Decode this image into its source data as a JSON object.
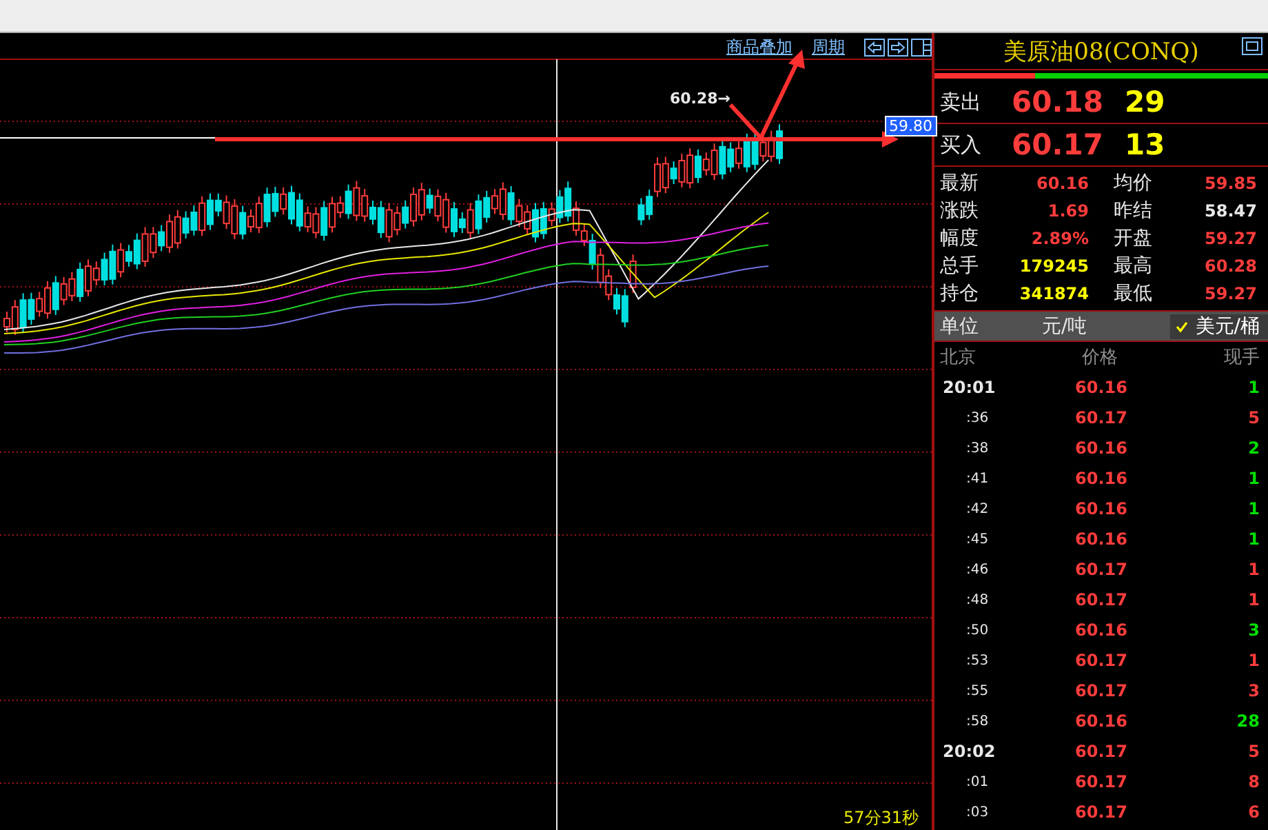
{
  "chart": {
    "links": [
      "商品叠加",
      "周期"
    ],
    "high_label": "60.28→",
    "price_tag": "59.80",
    "timer": "57分31秒"
  },
  "quote": {
    "title": "美原油08(CONQ)",
    "sell": {
      "label": "卖出",
      "price": "60.18",
      "volume": "29"
    },
    "buy": {
      "label": "买入",
      "price": "60.17",
      "volume": "13"
    },
    "stats": [
      {
        "label": "最新",
        "value": "60.16",
        "color": "#ff3c3c"
      },
      {
        "label": "均价",
        "value": "59.85",
        "color": "#ff3c3c"
      },
      {
        "label": "涨跌",
        "value": "1.69",
        "color": "#ff3c3c"
      },
      {
        "label": "昨结",
        "value": "58.47",
        "color": "#e8e8e8"
      },
      {
        "label": "幅度",
        "value": "2.89%",
        "color": "#ff3c3c"
      },
      {
        "label": "开盘",
        "value": "59.27",
        "color": "#ff3c3c"
      },
      {
        "label": "总手",
        "value": "179245",
        "color": "#ffff00"
      },
      {
        "label": "最高",
        "value": "60.28",
        "color": "#ff3c3c"
      },
      {
        "label": "持仓",
        "value": "341874",
        "color": "#ffff00"
      },
      {
        "label": "最低",
        "value": "59.27",
        "color": "#ff3c3c"
      }
    ],
    "units": {
      "label": "单位",
      "options": [
        {
          "label": "元/吨",
          "selected": false
        },
        {
          "label": "美元/桶",
          "selected": true
        }
      ]
    },
    "trades_header": [
      "北京",
      "价格",
      "现手"
    ],
    "trades": [
      {
        "time": "20:01",
        "major": true,
        "price": "60.16",
        "qty": "1",
        "color": "#00e000"
      },
      {
        "time": ":36",
        "major": false,
        "price": "60.17",
        "qty": "5",
        "color": "#ff3c3c"
      },
      {
        "time": ":38",
        "major": false,
        "price": "60.16",
        "qty": "2",
        "color": "#00e000"
      },
      {
        "time": ":41",
        "major": false,
        "price": "60.16",
        "qty": "1",
        "color": "#00e000"
      },
      {
        "time": ":42",
        "major": false,
        "price": "60.16",
        "qty": "1",
        "color": "#00e000"
      },
      {
        "time": ":45",
        "major": false,
        "price": "60.16",
        "qty": "1",
        "color": "#00e000"
      },
      {
        "time": ":46",
        "major": false,
        "price": "60.17",
        "qty": "1",
        "color": "#ff3c3c"
      },
      {
        "time": ":48",
        "major": false,
        "price": "60.17",
        "qty": "1",
        "color": "#ff3c3c"
      },
      {
        "time": ":50",
        "major": false,
        "price": "60.16",
        "qty": "3",
        "color": "#00e000"
      },
      {
        "time": ":53",
        "major": false,
        "price": "60.17",
        "qty": "1",
        "color": "#ff3c3c"
      },
      {
        "time": ":55",
        "major": false,
        "price": "60.17",
        "qty": "3",
        "color": "#ff3c3c"
      },
      {
        "time": ":58",
        "major": false,
        "price": "60.16",
        "qty": "28",
        "color": "#00e000"
      },
      {
        "time": "20:02",
        "major": true,
        "price": "60.17",
        "qty": "5",
        "color": "#ff3c3c"
      },
      {
        "time": ":01",
        "major": false,
        "price": "60.17",
        "qty": "8",
        "color": "#ff3c3c"
      },
      {
        "time": ":03",
        "major": false,
        "price": "60.17",
        "qty": "6",
        "color": "#ff3c3c"
      }
    ]
  }
}
